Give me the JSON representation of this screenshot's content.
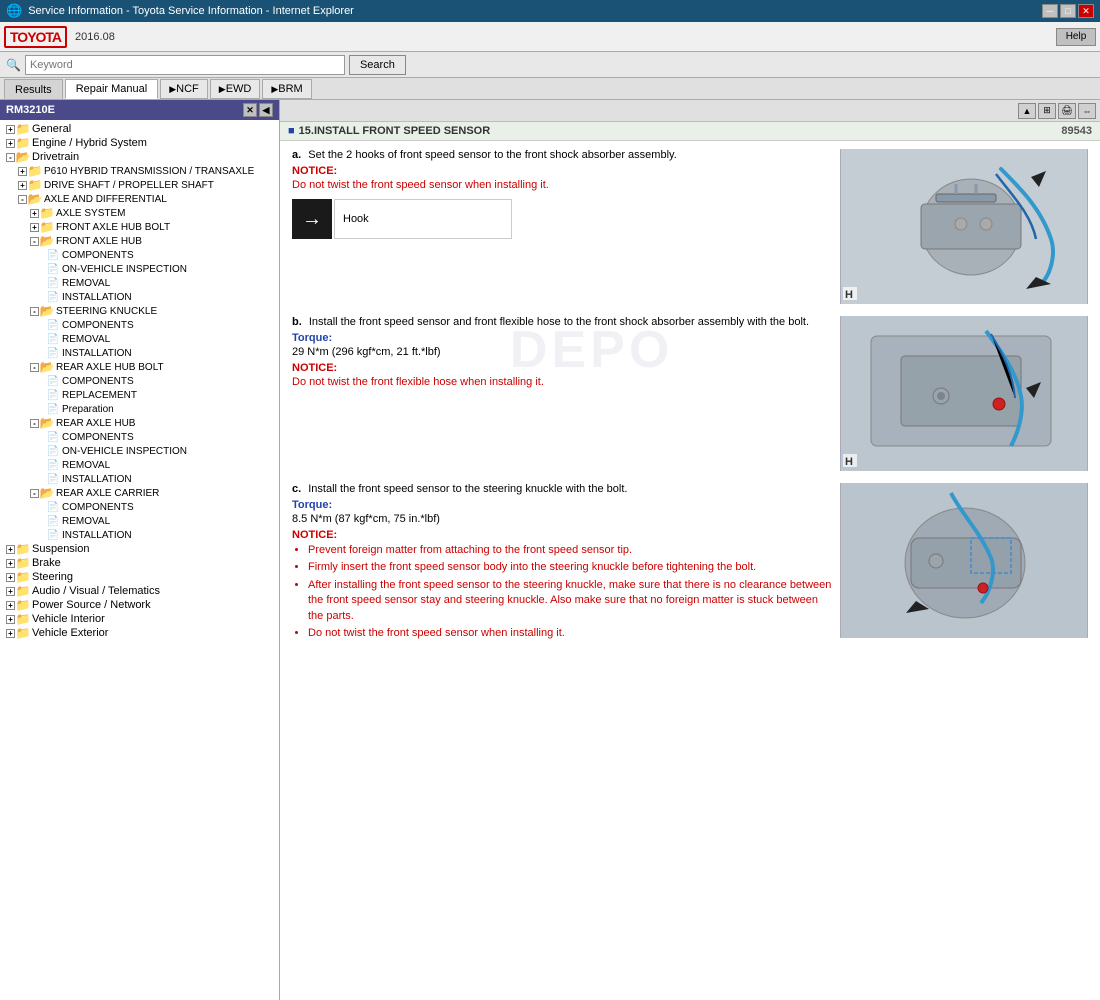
{
  "window": {
    "title": "Service Information - Toyota Service Information - Internet Explorer",
    "version": "2016.08",
    "controls": [
      "minimize",
      "maximize",
      "close"
    ]
  },
  "toolbar": {
    "search_placeholder": "Keyword",
    "search_btn": "Search",
    "help_btn": "Help"
  },
  "tabs": {
    "results": "Results",
    "repair_manual": "Repair Manual",
    "ncf": "NCF",
    "ewd": "EWD",
    "brm": "BRM"
  },
  "left_panel": {
    "title": "RM3210E",
    "tree": [
      {
        "id": "general",
        "label": "General",
        "level": 0,
        "type": "folder",
        "state": "collapsed"
      },
      {
        "id": "engine",
        "label": "Engine / Hybrid System",
        "level": 0,
        "type": "folder",
        "state": "collapsed"
      },
      {
        "id": "drivetrain",
        "label": "Drivetrain",
        "level": 0,
        "type": "folder",
        "state": "expanded"
      },
      {
        "id": "p610",
        "label": "P610 HYBRID TRANSMISSION / TRANSAXLE",
        "level": 1,
        "type": "folder",
        "state": "collapsed"
      },
      {
        "id": "driveshaft",
        "label": "DRIVE SHAFT / PROPELLER SHAFT",
        "level": 1,
        "type": "folder",
        "state": "collapsed"
      },
      {
        "id": "axle_diff",
        "label": "AXLE AND DIFFERENTIAL",
        "level": 1,
        "type": "folder",
        "state": "expanded"
      },
      {
        "id": "axle_system",
        "label": "AXLE SYSTEM",
        "level": 2,
        "type": "folder",
        "state": "collapsed"
      },
      {
        "id": "front_axle_hub_bolt",
        "label": "FRONT AXLE HUB BOLT",
        "level": 2,
        "type": "folder",
        "state": "collapsed"
      },
      {
        "id": "front_axle_hub",
        "label": "FRONT AXLE HUB",
        "level": 2,
        "type": "folder",
        "state": "expanded"
      },
      {
        "id": "front_axle_hub_components",
        "label": "COMPONENTS",
        "level": 3,
        "type": "doc",
        "state": null
      },
      {
        "id": "front_axle_hub_inspection",
        "label": "ON-VEHICLE INSPECTION",
        "level": 3,
        "type": "doc",
        "state": null
      },
      {
        "id": "front_axle_hub_removal",
        "label": "REMOVAL",
        "level": 3,
        "type": "doc",
        "state": null
      },
      {
        "id": "front_axle_hub_installation",
        "label": "INSTALLATION",
        "level": 3,
        "type": "doc",
        "state": null
      },
      {
        "id": "steering_knuckle",
        "label": "STEERING KNUCKLE",
        "level": 2,
        "type": "folder",
        "state": "expanded"
      },
      {
        "id": "steering_knuckle_components",
        "label": "COMPONENTS",
        "level": 3,
        "type": "doc",
        "state": null
      },
      {
        "id": "steering_knuckle_removal",
        "label": "REMOVAL",
        "level": 3,
        "type": "doc",
        "state": null
      },
      {
        "id": "steering_knuckle_installation",
        "label": "INSTALLATION",
        "level": 3,
        "type": "doc",
        "state": null
      },
      {
        "id": "rear_axle_hub_bolt",
        "label": "REAR AXLE HUB BOLT",
        "level": 2,
        "type": "folder",
        "state": "expanded"
      },
      {
        "id": "rear_axle_hub_bolt_components",
        "label": "COMPONENTS",
        "level": 3,
        "type": "doc",
        "state": null
      },
      {
        "id": "rear_axle_hub_bolt_replacement",
        "label": "REPLACEMENT",
        "level": 3,
        "type": "doc",
        "state": null
      },
      {
        "id": "rear_axle_hub_bolt_preparation",
        "label": "Preparation",
        "level": 3,
        "type": "doc",
        "state": null
      },
      {
        "id": "rear_axle_hub",
        "label": "REAR AXLE HUB",
        "level": 2,
        "type": "folder",
        "state": "expanded"
      },
      {
        "id": "rear_axle_hub_components",
        "label": "COMPONENTS",
        "level": 3,
        "type": "doc",
        "state": null
      },
      {
        "id": "rear_axle_hub_inspection",
        "label": "ON-VEHICLE INSPECTION",
        "level": 3,
        "type": "doc",
        "state": null
      },
      {
        "id": "rear_axle_hub_removal",
        "label": "REMOVAL",
        "level": 3,
        "type": "doc",
        "state": null
      },
      {
        "id": "rear_axle_hub_installation",
        "label": "INSTALLATION",
        "level": 3,
        "type": "doc",
        "state": null
      },
      {
        "id": "rear_axle_carrier",
        "label": "REAR AXLE CARRIER",
        "level": 2,
        "type": "folder",
        "state": "expanded"
      },
      {
        "id": "rear_axle_carrier_components",
        "label": "COMPONENTS",
        "level": 3,
        "type": "doc",
        "state": null
      },
      {
        "id": "rear_axle_carrier_removal",
        "label": "REMOVAL",
        "level": 3,
        "type": "doc",
        "state": null
      },
      {
        "id": "rear_axle_carrier_installation",
        "label": "INSTALLATION",
        "level": 3,
        "type": "doc",
        "state": null
      },
      {
        "id": "suspension",
        "label": "Suspension",
        "level": 0,
        "type": "folder",
        "state": "collapsed"
      },
      {
        "id": "brake",
        "label": "Brake",
        "level": 0,
        "type": "folder",
        "state": "collapsed"
      },
      {
        "id": "steering",
        "label": "Steering",
        "level": 0,
        "type": "folder",
        "state": "collapsed"
      },
      {
        "id": "audio_visual",
        "label": "Audio / Visual / Telematics",
        "level": 0,
        "type": "folder",
        "state": "collapsed"
      },
      {
        "id": "power_source",
        "label": "Power Source / Network",
        "level": 0,
        "type": "folder",
        "state": "collapsed"
      },
      {
        "id": "vehicle_interior",
        "label": "Vehicle Interior",
        "level": 0,
        "type": "folder",
        "state": "collapsed"
      },
      {
        "id": "vehicle_exterior",
        "label": "Vehicle Exterior",
        "level": 0,
        "type": "folder",
        "state": "collapsed"
      }
    ]
  },
  "content": {
    "step_number": "15",
    "title": "15.INSTALL FRONT SPEED SENSOR",
    "ref_number": "89543",
    "step_a": {
      "label": "a.",
      "text": "Set the 2 hooks of front speed sensor to the front shock absorber assembly.",
      "notice_label": "NOTICE:",
      "notice_text": "Do not twist the front speed sensor when installing it.",
      "hook_label": "Hook"
    },
    "step_b": {
      "label": "b.",
      "text": "Install the front speed sensor and front flexible hose to the front shock absorber assembly with the bolt.",
      "torque_label": "Torque:",
      "torque_value": "29 N*m (296 kgf*cm, 21 ft.*lbf)",
      "notice_label": "NOTICE:",
      "notice_text": "Do not twist the front flexible hose when installing it."
    },
    "step_c": {
      "label": "c.",
      "text": "Install the front speed sensor to the steering knuckle with the bolt.",
      "torque_label": "Torque:",
      "torque_value": "8.5 N*m (87 kgf*cm, 75 in.*lbf)",
      "notice_label": "NOTICE:",
      "bullets": [
        "Prevent foreign matter from attaching to the front speed sensor tip.",
        "Firmly insert the front speed sensor body into the steering knuckle before tightening the bolt.",
        "After installing the front speed sensor to the steering knuckle, make sure that there is no clearance between the front speed sensor stay and steering knuckle. Also make sure that no foreign matter is stuck between the parts.",
        "Do not twist the front speed sensor when installing it."
      ]
    }
  },
  "watermark": "DEPO"
}
